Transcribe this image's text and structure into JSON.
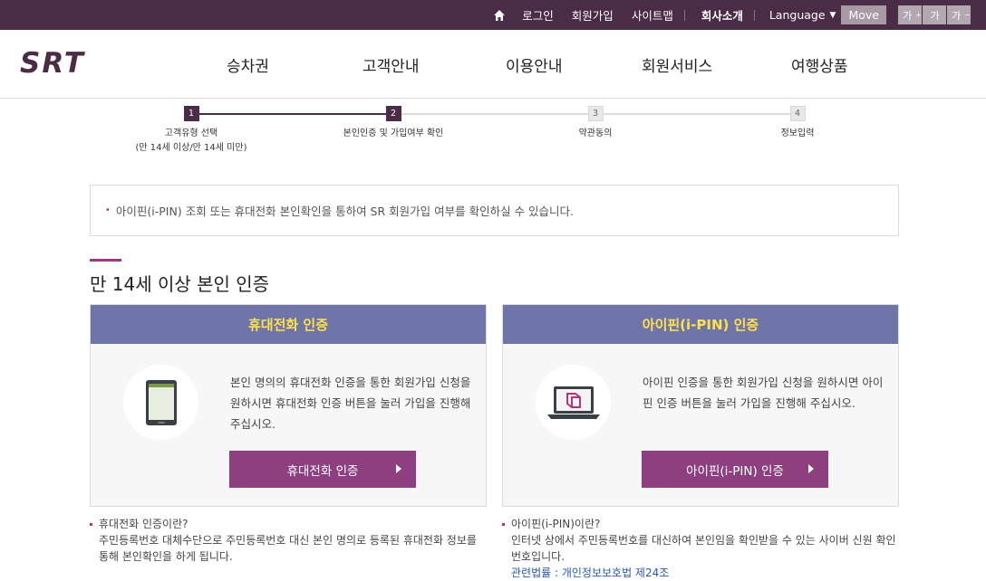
{
  "topbar": {
    "links": [
      "로그인",
      "회원가입",
      "사이트맵"
    ],
    "company": "회사소개",
    "language": "Language",
    "move": "Move",
    "font_sizes": [
      "가",
      "가",
      "가"
    ]
  },
  "header": {
    "logo_text": "SRT",
    "nav": [
      "승차권",
      "고객안내",
      "이용안내",
      "회원서비스",
      "여행상품"
    ]
  },
  "steps": [
    {
      "num": "1",
      "label": "고객유형 선택",
      "sub": "(만 14세 이상/만 14세 미만)",
      "active": true
    },
    {
      "num": "2",
      "label": "본인인증 및 가입여부 확인",
      "sub": "",
      "active": true
    },
    {
      "num": "3",
      "label": "약관동의",
      "sub": "",
      "active": false
    },
    {
      "num": "4",
      "label": "정보입력",
      "sub": "",
      "active": false
    }
  ],
  "notice": "아이핀(i-PIN) 조회 또는 휴대전화 본인확인을 통하여 SR 회원가입 여부를 확인하실 수 있습니다.",
  "section_title": "만 14세 이상 본인 인증",
  "cards": [
    {
      "title": "휴대전화 인증",
      "desc": "본인 명의의 휴대전화 인증을 통한 회원가입 신청을 원하시면 휴대전화 인증 버튼을 눌러 가입을 진행해 주십시오.",
      "button": "휴대전화 인증"
    },
    {
      "title": "아이핀(i-PIN) 인증",
      "desc": "아이핀 인증을 통한 회원가입 신청을 원하시면 아이핀 인증 버튼을 눌러 가입을 진행해 주십시오.",
      "button": "아이핀(i-PIN) 인증"
    }
  ],
  "info": [
    {
      "title": "휴대전화 인증이란?",
      "body": "주민등록번호 대체수단으로 주민등록번호 대신 본인 명의로 등록된 휴대전화 정보를 통해 본인확인을 하게 됩니다.",
      "law": ""
    },
    {
      "title": "아이핀(i-PIN)이란?",
      "body": "인터넷 상에서 주민등록번호를 대신하여 본인임을 확인받을 수 있는 사이버 신원 확인번호입니다.",
      "law": "관련법률 : 개인정보보호법 제24조"
    }
  ],
  "colors": {
    "topbar": "#4a2c46",
    "accent": "#a0387f",
    "card_header": "#6f75a8",
    "card_title": "#ffe24a",
    "button": "#8d3f80"
  }
}
